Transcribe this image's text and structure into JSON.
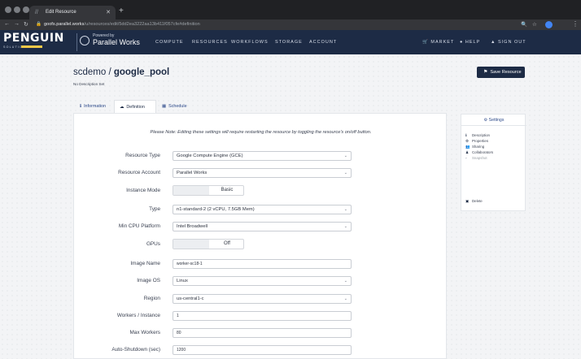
{
  "browser": {
    "tab_title": "Edit Resource",
    "tab_icon": "parallelworks-favicon",
    "url_host": "goofs.parallel.works",
    "url_path": "/u/resources/edit/5dd2ea3222aa13b411f057cfe#definition"
  },
  "app": {
    "brand_name": "PENGUIN",
    "brand_sub": "SOLUTIONS",
    "powered_by": "Powered by",
    "powered_name": "Parallel Works",
    "nav": [
      "COMPUTE",
      "RESOURCES",
      "WORKFLOWS",
      "STORAGE",
      "ACCOUNT"
    ],
    "nav_right": {
      "market": "MARKET",
      "help": "HELP",
      "sign_out": "SIGN OUT"
    }
  },
  "page": {
    "title_owner": "scdemo / ",
    "title_name": "google_pool",
    "subtitle": "No Description Set",
    "save_label": "Save Resource",
    "tabs": [
      {
        "label": "Information",
        "icon": "info-icon"
      },
      {
        "label": "Definition",
        "icon": "cloud-icon"
      },
      {
        "label": "Schedule",
        "icon": "calendar-icon"
      }
    ],
    "note": "Please Note: Editing these settings will require restarting the resource by toggling the resource's on/off button.",
    "form": {
      "resource_type": {
        "label": "Resource Type",
        "value": "Google Compute Engine (GCE)"
      },
      "resource_account": {
        "label": "Resource Account",
        "value": "Parallel Works"
      },
      "instance_mode": {
        "label": "Instance Mode",
        "value": "Basic"
      },
      "type": {
        "label": "Type",
        "value": "n1-standard-2 (2 vCPU, 7.5GB Mem)"
      },
      "min_cpu": {
        "label": "Min CPU Platform",
        "value": "Intel Broadwell"
      },
      "gpus": {
        "label": "GPUs",
        "value": "Off"
      },
      "image_name": {
        "label": "Image Name",
        "value": "worker-sc18-1"
      },
      "image_os": {
        "label": "Image OS",
        "value": "Linux"
      },
      "region": {
        "label": "Region",
        "value": "us-central1-c"
      },
      "workers_instance": {
        "label": "Workers / Instance",
        "value": "1"
      },
      "max_workers": {
        "label": "Max Workers",
        "value": "80"
      },
      "auto_shutdown": {
        "label": "Auto-Shutdown (sec)",
        "value": "1200"
      }
    }
  },
  "sidebar": {
    "header": "Settings",
    "items": [
      "Description",
      "Properties",
      "Sharing",
      "Collaborators",
      "Snapshot"
    ],
    "delete": "Delete"
  }
}
